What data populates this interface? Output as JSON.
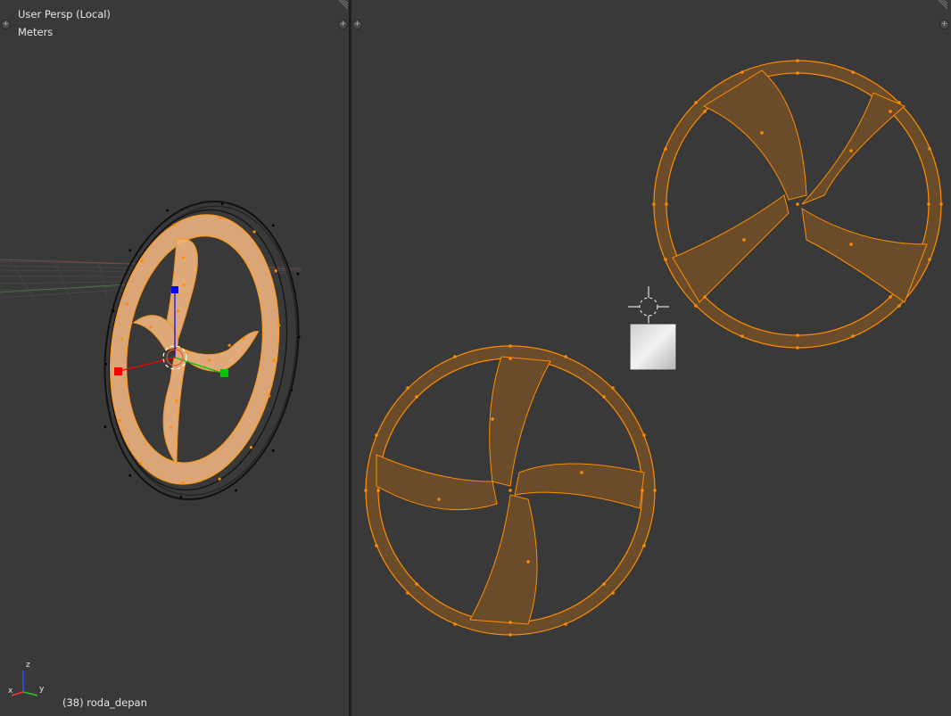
{
  "left_viewport": {
    "view_name": "User Persp (Local)",
    "units": "Meters",
    "object_info": "(38) roda_depan",
    "axis_labels": {
      "x": "x",
      "y": "y",
      "z": "z"
    }
  },
  "right_viewport": {
    "view": "UV / Image Editor"
  },
  "colors": {
    "background": "#393939",
    "mesh_fill_3d": "#e8b07d",
    "uv_fill": "#6a4c2a",
    "selection": "#ff8c00",
    "wire": "#000000",
    "axis_x": "#ff0000",
    "axis_y": "#00c800",
    "axis_z": "#0000ff"
  }
}
